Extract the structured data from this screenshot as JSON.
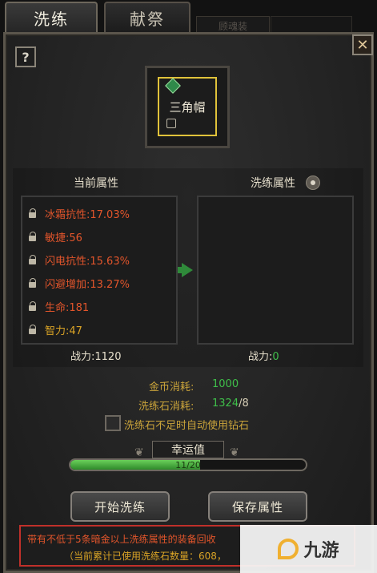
{
  "tabs": {
    "active": "洗练",
    "inactive": "献祭",
    "ghost": "顾魂装"
  },
  "help": "?",
  "close": "✕",
  "item": {
    "name": "三角帽"
  },
  "current": {
    "header": "当前属性",
    "attributes": [
      {
        "text": "冰霜抗性:17.03%",
        "color": "#e2552b"
      },
      {
        "text": "敏捷:56",
        "color": "#e2552b"
      },
      {
        "text": "闪电抗性:15.63%",
        "color": "#e2552b"
      },
      {
        "text": "闪避增加:13.27%",
        "color": "#e2552b"
      },
      {
        "text": "生命:181",
        "color": "#e2552b"
      },
      {
        "text": "智力:47",
        "color": "#d9a326"
      }
    ],
    "power_label": "战力:",
    "power_value": "1120"
  },
  "refined": {
    "header": "洗练属性",
    "power_label": "战力:",
    "power_value": "0"
  },
  "cost": {
    "gold_label": "金币消耗:",
    "gold_value": "1000",
    "stone_label": "洗练石消耗:",
    "stone_have": "1324",
    "stone_need": "/8",
    "auto_diamond_label": "洗练石不足时自动使用钻石"
  },
  "luck": {
    "title": "幸运值",
    "text": "11/20",
    "fraction": 0.55
  },
  "buttons": {
    "start": "开始洗练",
    "save": "保存属性"
  },
  "notice": {
    "line1": "带有不低于5条暗金以上洗练属性的装备回收",
    "line2": "（当前累计已使用洗练石数量：608，"
  },
  "watermark": "九游",
  "colors": {
    "accent_gold": "#e0c23a",
    "attr_red": "#e2552b",
    "attr_gold": "#d9a326",
    "green": "#3fbf4a",
    "notice_border": "#c0302a"
  }
}
